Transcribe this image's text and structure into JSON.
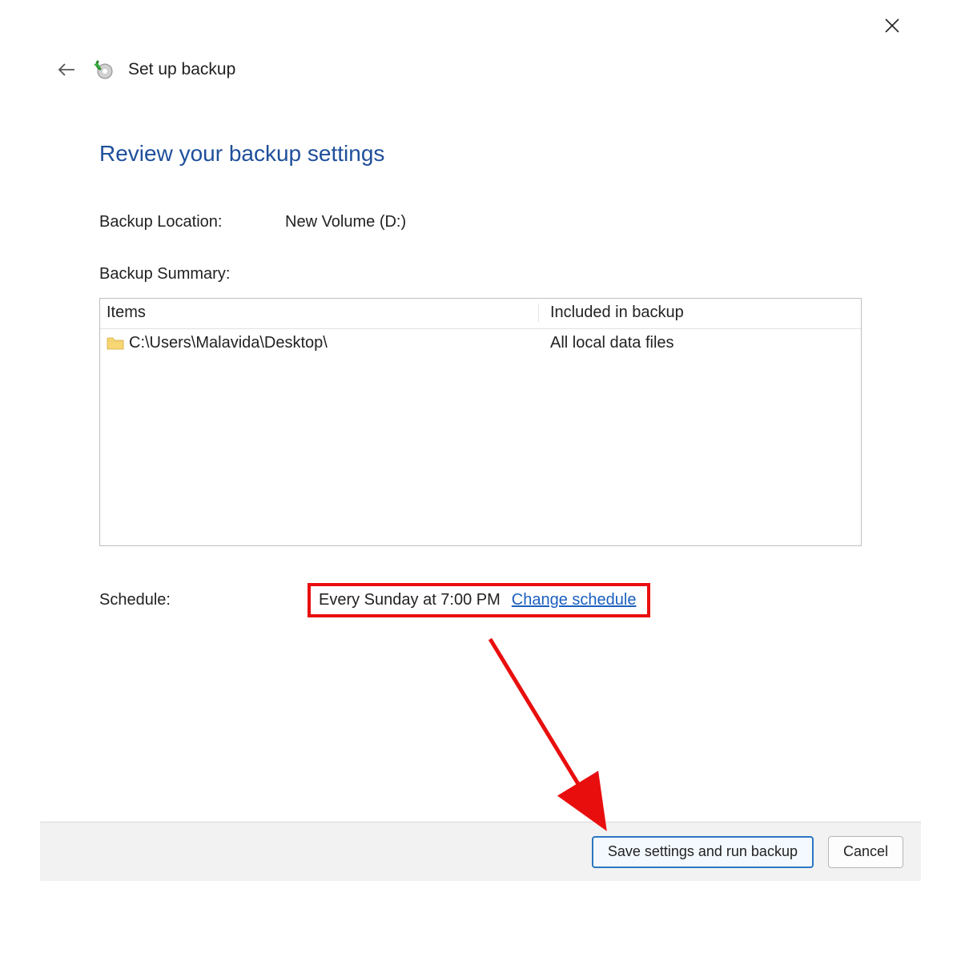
{
  "window": {
    "title": "Set up backup"
  },
  "page": {
    "heading": "Review your backup settings"
  },
  "fields": {
    "backup_location_label": "Backup Location:",
    "backup_location_value": "New Volume (D:)",
    "backup_summary_label": "Backup Summary:"
  },
  "summary_table": {
    "col1_header": "Items",
    "col2_header": "Included in backup",
    "rows": [
      {
        "path": "C:\\Users\\Malavida\\Desktop\\",
        "included": "All local data files"
      }
    ]
  },
  "schedule": {
    "label": "Schedule:",
    "value": "Every Sunday at 7:00 PM",
    "change_link": "Change schedule"
  },
  "buttons": {
    "save_run": "Save settings and run backup",
    "cancel": "Cancel"
  }
}
